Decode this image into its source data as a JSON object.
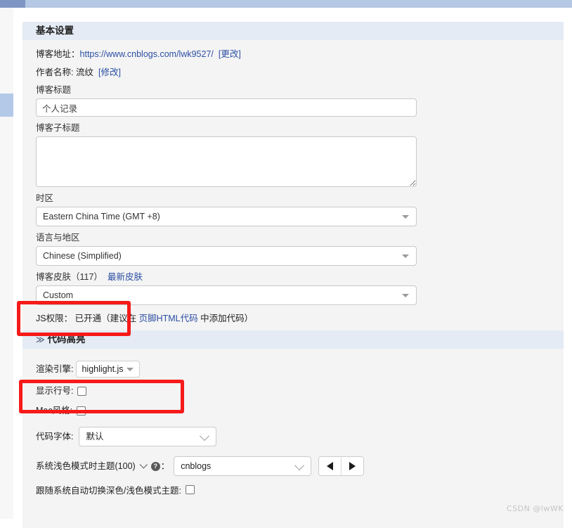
{
  "window": {
    "topbar_color": "#b4c7e3",
    "topbar_accent_color": "#7f96c4",
    "scrollbar_thumb_color": "#b4c9e7"
  },
  "basic_section": {
    "header": "基本设置",
    "blog_address": {
      "label": "博客地址：",
      "url": "https://www.cnblogs.com/lwk9527/",
      "change_link": "[更改]"
    },
    "author_name": {
      "label": "作者名称:",
      "value": "流纹",
      "edit_link": "[修改]"
    },
    "blog_title": {
      "label": "博客标题",
      "value": "个人记录",
      "placeholder": ""
    },
    "blog_subtitle": {
      "label": "博客子标题",
      "value": "",
      "placeholder": ""
    },
    "timezone": {
      "label": "时区",
      "value": "Eastern China Time (GMT +8)"
    },
    "language": {
      "label": "语言与地区",
      "value": "Chinese (Simplified)"
    },
    "skin": {
      "label": "博客皮肤（117）",
      "newest_link": "最新皮肤",
      "value": "Custom"
    },
    "js_permission": {
      "label": "JS权限：",
      "status": "已开通",
      "hint_prefix": "（建议在 ",
      "hint_link": "页脚HTML代码",
      "hint_suffix": " 中添加代码）"
    }
  },
  "highlight_section": {
    "header": "代码高亮",
    "chevron": "≫",
    "render_engine": {
      "label": "渲染引擎:",
      "value": "highlight.js"
    },
    "line_numbers": {
      "label": "显示行号:",
      "checked": false
    },
    "mac_style": {
      "label": "Mac风格:",
      "checked": false
    },
    "code_font": {
      "label": "代码字体:",
      "value": "默认"
    },
    "light_theme": {
      "label": "系统浅色模式时主题(100)",
      "help_badge": "?",
      "colon": "：",
      "value": "cnblogs",
      "prev_button": "◀",
      "next_button": "▶"
    },
    "auto_switch": {
      "label": "跟随系统自动切换深色/浅色模式主题:",
      "checked": false
    }
  },
  "annotations": {
    "highlight_color": "#f61a1a",
    "boxes": [
      "skin-select-box",
      "render-engine-box"
    ]
  },
  "watermark": "CSDN @lwWK"
}
